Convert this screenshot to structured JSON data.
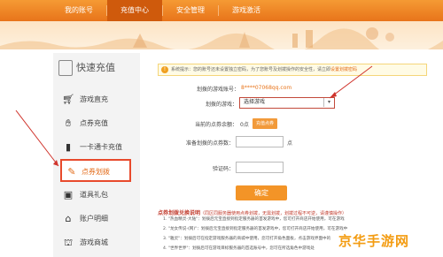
{
  "topnav": {
    "items": [
      "我的账号",
      "充值中心",
      "安全管理",
      "游戏激活"
    ],
    "active_index": 1
  },
  "sidebar": {
    "title": "快速充值",
    "items": [
      {
        "label": "游戏直充",
        "icon": "cart-icon"
      },
      {
        "label": "点券充值",
        "icon": "paw-icon"
      },
      {
        "label": "一卡通卡充值",
        "icon": "card-icon"
      },
      {
        "label": "点券划拨",
        "icon": "transfer-icon",
        "active": true
      },
      {
        "label": "道具礼包",
        "icon": "box-icon"
      },
      {
        "label": "账户明细",
        "icon": "home-icon"
      },
      {
        "label": "游戏商城",
        "icon": "shop-icon"
      }
    ]
  },
  "notice": {
    "text": "系统提示：您的账号还未设置独立密码，为了您账号及划拨操作的安全性，请立即",
    "link": "设置划拨密码"
  },
  "form": {
    "account_label": "划拨的游戏账号：",
    "account_value": "8****07068qq.com",
    "game_label": "划拨的游戏：",
    "game_select_value": "选择游戏",
    "balance_label": "当前的点券余额：",
    "balance_value": "0点",
    "balance_button": "充值点券",
    "amount_label": "准备划拨的点券数：",
    "amount_unit": "点",
    "captcha_label": "验证码：",
    "submit_label": "确定"
  },
  "rules": {
    "title": "点券划拨兑换说明",
    "subtitle": "（同区同服务器使用点券划拨，无需划拨，划拨过程不可逆，请谨慎操作）",
    "lines": [
      "1. \"热血精灵-大陆\"：划拨后元宝直接到指定服务器的首发游戏中，您可打开商店开始使用，可在游戏",
      "2. \"龙女传说-(网)\"：划拨后元宝直接到指定服务器的首发游戏中，您可打开商店开始使用，可在游戏中",
      "3. \"雅灵\"：划拨后可在指定游戏服务器的商城中使用，您可打开角色面板，点击游戏界面中的",
      "4. \"世界世界\"：划拨后可在游戏目标服务器的首选账号中，您可在所选角色中游戏处"
    ]
  },
  "watermark": "京华手游网"
}
